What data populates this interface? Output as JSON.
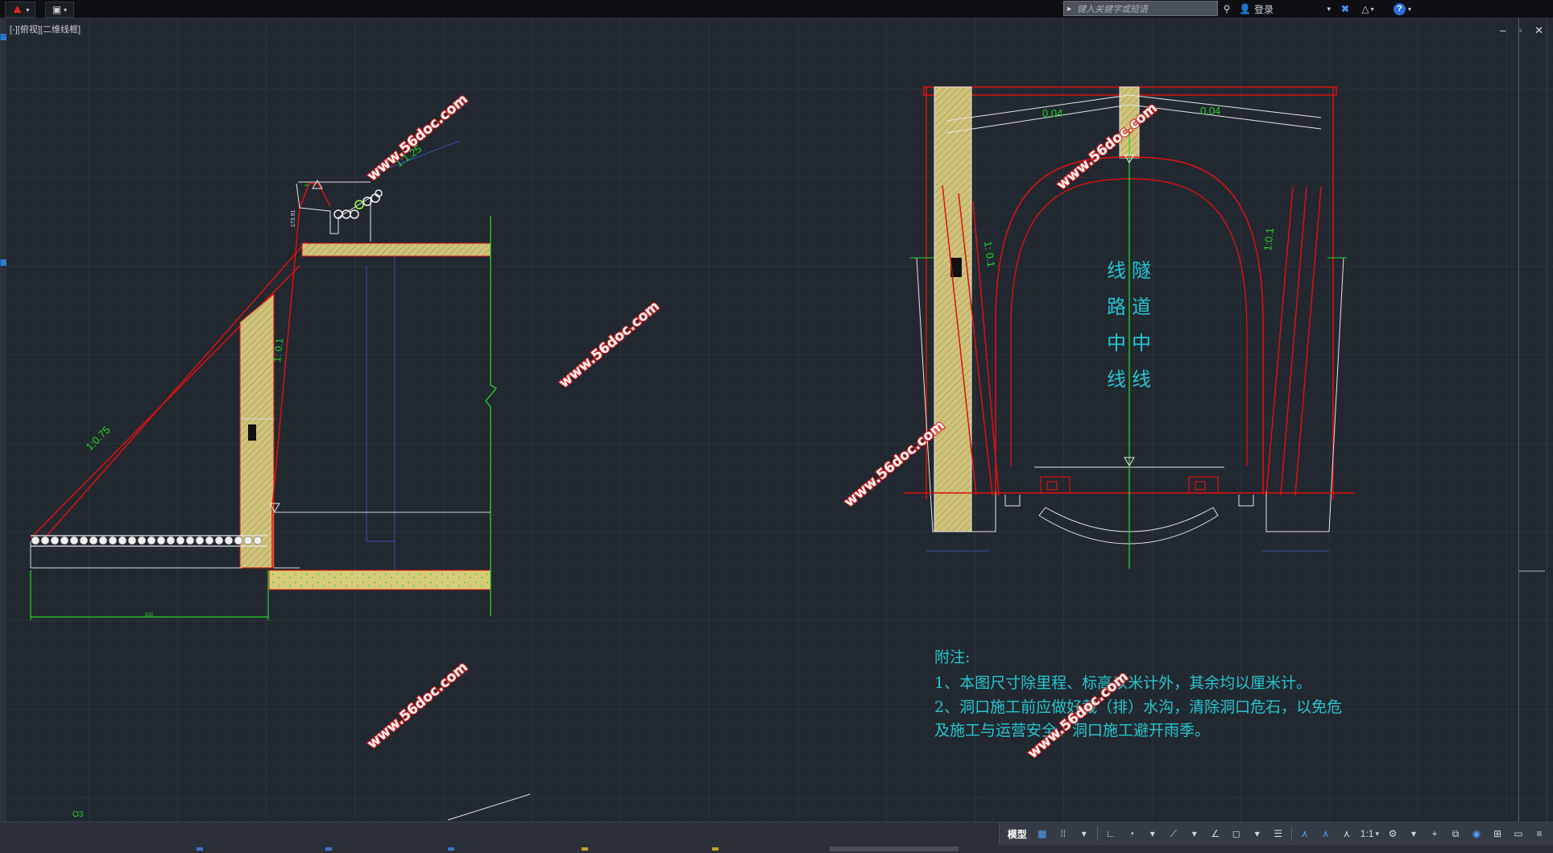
{
  "titlebar": {
    "app_icon": "autocad-a-logo-icon",
    "search_placeholder": "键入关键字或短语",
    "user_label": "登录",
    "help_label": "?"
  },
  "viewport": {
    "label": "[-][俯视][二维线框]",
    "controls": "– ▫ ✕"
  },
  "drawing": {
    "watermark": "www.56doc.com",
    "left_section": {
      "slope_main": "1:0.75",
      "slope_top": "1:1.25",
      "slope_wall": "1: 0.1",
      "dim_bottom": "830",
      "dim_small_vertical": "173.91"
    },
    "right_section": {
      "grade_left": "0.04",
      "grade_right": "0.04",
      "slope_left": "1: 0.1",
      "slope_right": "1:0.1",
      "center_label_col1": [
        "隧",
        "道",
        "中",
        "线"
      ],
      "center_label_col2": [
        "线",
        "路",
        "中",
        "线"
      ]
    },
    "notes": {
      "title": "附注:",
      "line1": "1、本图尺寸除里程、标高以米计外，其余均以厘米计。",
      "line2": "2、洞口施工前应做好截（排）水沟，清除洞口危石，以免危",
      "line3": "及施工与运营安全。洞口施工避开雨季。"
    },
    "ucs_label": "O3"
  },
  "statusbar": {
    "model_label": "模型",
    "scale_label": "1:1"
  },
  "colors": {
    "background": "#212830",
    "grid_minor": "#283039",
    "grid_major": "#323b46",
    "red_line": "#e01010",
    "green_text": "#28d428",
    "cyan_text": "#26c6d0",
    "yellow_fill": "#d8cc7a",
    "watermark_red": "#e02020"
  }
}
